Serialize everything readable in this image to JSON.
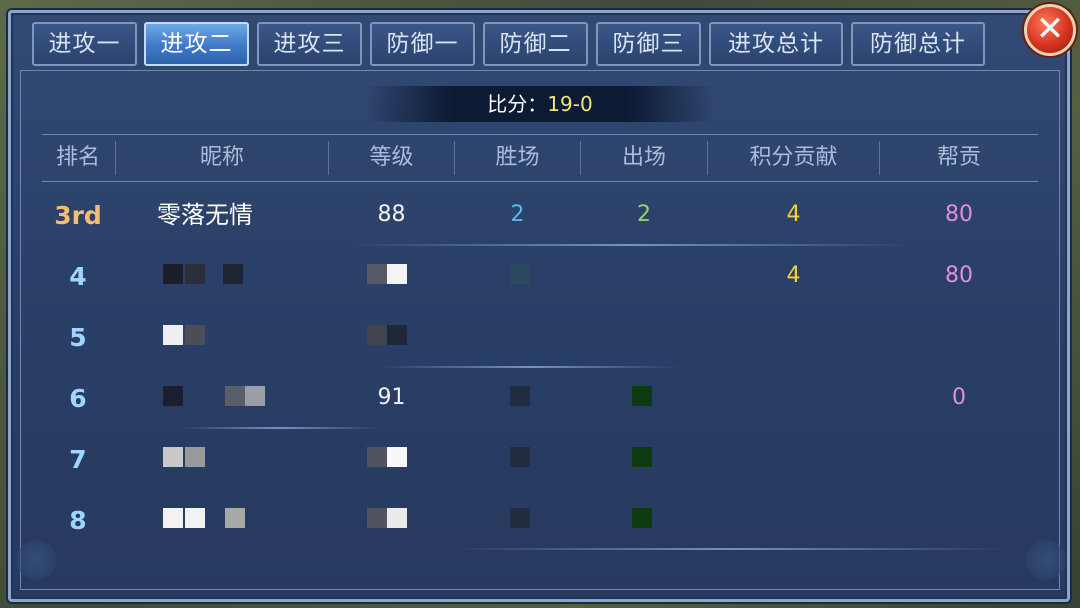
{
  "tabs": [
    {
      "label": "进攻一",
      "active": false
    },
    {
      "label": "进攻二",
      "active": true
    },
    {
      "label": "进攻三",
      "active": false
    },
    {
      "label": "防御一",
      "active": false
    },
    {
      "label": "防御二",
      "active": false
    },
    {
      "label": "防御三",
      "active": false
    },
    {
      "label": "进攻总计",
      "active": false
    },
    {
      "label": "防御总计",
      "active": false
    }
  ],
  "close_icon": "close-icon",
  "score": {
    "label": "比分：",
    "value": "19-0"
  },
  "columns": [
    "排名",
    "昵称",
    "等级",
    "胜场",
    "出场",
    "积分贡献",
    "帮贡"
  ],
  "rows": [
    {
      "rank": "3rd",
      "name": "零落无情",
      "level": "88",
      "wins": "2",
      "appearances": "2",
      "points": "4",
      "contribution": "80"
    },
    {
      "rank": "4",
      "name": "",
      "level": "",
      "wins": "",
      "appearances": "",
      "points": "4",
      "contribution": "80"
    },
    {
      "rank": "5",
      "name": "",
      "level": "",
      "wins": "",
      "appearances": "",
      "points": "",
      "contribution": ""
    },
    {
      "rank": "6",
      "name": "",
      "level": "91",
      "wins": "",
      "appearances": "",
      "points": "",
      "contribution": "0"
    },
    {
      "rank": "7",
      "name": "",
      "level": "",
      "wins": "",
      "appearances": "",
      "points": "",
      "contribution": ""
    },
    {
      "rank": "8",
      "name": "",
      "level": "",
      "wins": "",
      "appearances": "",
      "points": "",
      "contribution": ""
    }
  ],
  "colors": {
    "rank_top": "#f0c070",
    "rank_normal": "#9fd6ff",
    "wins": "#59b9e8",
    "appearances": "#8fd46a",
    "points": "#f3cf3a",
    "contribution": "#e58be0"
  }
}
